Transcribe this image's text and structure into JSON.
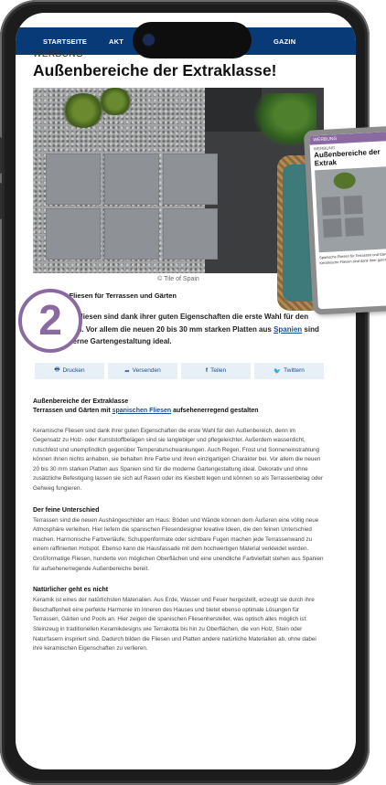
{
  "nav": {
    "items": [
      "STARTSEITE",
      "AKT",
      "GAZIN"
    ]
  },
  "article": {
    "kicker": "WERBUNG",
    "title": "Außenbereiche der Extraklasse!",
    "photo_credit": "© Tile of Spain",
    "section_heading": "Spanische Fliesen für Terrassen und Gärten",
    "intro_part1": "Keramische Fliesen sind dank ihrer guten Eigenschaften die erste Wahl für den Außenbereich. Vor allem die neuen 20 bis 30 mm starken Platten aus ",
    "intro_link": "Spanien",
    "intro_part2": " sind für die moderne Gartengestaltung ideal.",
    "step_number": "2"
  },
  "share": {
    "print": "Drucken",
    "send": "Versenden",
    "share": "Teilen",
    "twitter": "Twittern"
  },
  "body": {
    "title_line1": "Außenbereiche der Extraklasse",
    "title_line2_prefix": "Terrassen und Gärten mit ",
    "title_line2_link": "spanischen Fliesen",
    "title_line2_suffix": " aufsehenerregend gestalten",
    "para1": "Keramische Fliesen sind dank ihrer guten Eigenschaften die erste Wahl für den Außenbereich, denn im Gegensatz zu Holz- oder Kunststoffbelägen sind sie langlebiger und pflegeleichter. Außerdem wasserdicht, rutschfest und unempfindlich gegenüber Temperaturschwankungen. Auch Regen, Frost und Sonneneinstrahlung können ihnen nichts anhaben, sie behalten ihre Farbe und ihren einzigartigen Charakter bei. Vor allem die neuen 20 bis 30 mm starken Platten aus Spanien sind für die moderne Gartengestaltung ideal. Dekorativ und ohne zusätzliche Befestigung lassen sie sich auf Rasen oder ins Kiesbett legen und können so als Terrassenbelag oder Gehweg fungieren.",
    "heading2": "Der feine Unterschied",
    "para2": "Terrassen sind die neuen Aushängeschilder am Haus: Böden und Wände können dem Äußeren eine völlig neue Atmosphäre verleihen. Hier liefern die spanischen Fliesendesigner kreative Ideen, die den feinen Unterschied machen. Harmonische Farbverläufe, Schuppenformate oder sichtbare Fugen machen jede Terrassenwand zu einem raffinierten Hotspot. Ebenso kann die Hausfassade mit dem hochwertigen Material verkleidet werden. Großformatige Fliesen, hunderte von möglichen Oberflächen und eine unendliche Farbvielfalt stehen aus Spanien für aufsehenerregende Außenbereiche bereit.",
    "heading3": "Natürlicher geht es nicht",
    "para3": "Keramik ist eines der natürlichsten Materialien. Aus Erde, Wasser und Feuer hergestellt, erzeugt sie durch ihre Beschaffenheit eine perfekte Harmonie im Inneren des Hauses und bietet ebenso optimale Lösungen für Terrassen, Gärten und Pools an. Hier zeigen die spanischen Fliesenhersteller, was optisch alles möglich ist: Steinzeug in traditionellen Keramikdesigns wie Terrakotta bis hin zu Oberflächen, die von Holz, Stein oder Naturfasern inspiriert sind. Dadurch bilden die Fliesen und Platten andere natürliche Materialien ab, ohne dabei ihre keramischen Eigenschaften zu verlieren."
  },
  "magazine_card": {
    "tag": "WERBUNG",
    "kicker": "WERBUNG",
    "title": "Außenbereiche der Extrak",
    "caption": "Spanische Fliesen für Terrassen und Gärten. Keramische Fliesen sind dank ihrer guten"
  },
  "colors": {
    "nav_bg": "#083a78",
    "accent_purple": "#8b6aa1",
    "link_blue": "#1b4f8c",
    "share_bg": "#e9eff6"
  }
}
